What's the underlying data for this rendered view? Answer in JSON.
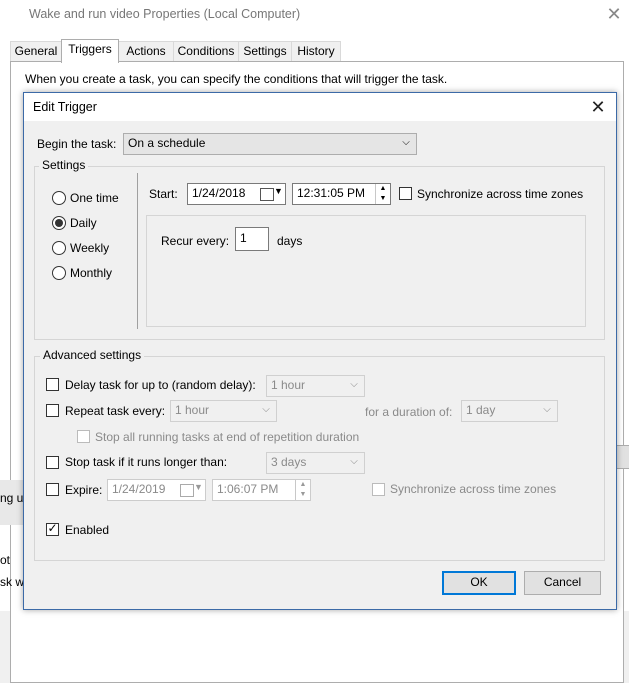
{
  "background_window": {
    "title": "Wake and run video Properties (Local Computer)",
    "tabs": [
      "General",
      "Triggers",
      "Actions",
      "Conditions",
      "Settings",
      "History"
    ],
    "active_tab": "Triggers",
    "description": "When you create a task, you can specify the conditions that will trigger the task.",
    "partial_text": [
      "ng u",
      "ot",
      "sk wi"
    ]
  },
  "dialog": {
    "title": "Edit Trigger",
    "begin_label": "Begin the task:",
    "begin_value": "On a schedule",
    "settings_group": "Settings",
    "schedule_options": [
      "One time",
      "Daily",
      "Weekly",
      "Monthly"
    ],
    "selected_option": "Daily",
    "start_label": "Start:",
    "start_date": "1/24/2018",
    "start_time": "12:31:05 PM",
    "sync_label": "Synchronize across time zones",
    "recur_label": "Recur every:",
    "recur_value": "1",
    "recur_unit": "days",
    "advanced_group": "Advanced settings",
    "delay_label": "Delay task for up to (random delay):",
    "delay_value": "1 hour",
    "repeat_label": "Repeat task every:",
    "repeat_value": "1 hour",
    "duration_label": "for a duration of:",
    "duration_value": "1 day",
    "stop_running_label": "Stop all running tasks at end of repetition duration",
    "stop_longer_label": "Stop task if it runs longer than:",
    "stop_longer_value": "3 days",
    "expire_label": "Expire:",
    "expire_date": "1/24/2019",
    "expire_time": "1:06:07 PM",
    "expire_sync_label": "Synchronize across time zones",
    "enabled_label": "Enabled",
    "ok_label": "OK",
    "cancel_label": "Cancel"
  },
  "colors": {
    "accent": "#0078d7",
    "border": "#3c6aa7",
    "dialog_bg": "#f0f0f0"
  }
}
